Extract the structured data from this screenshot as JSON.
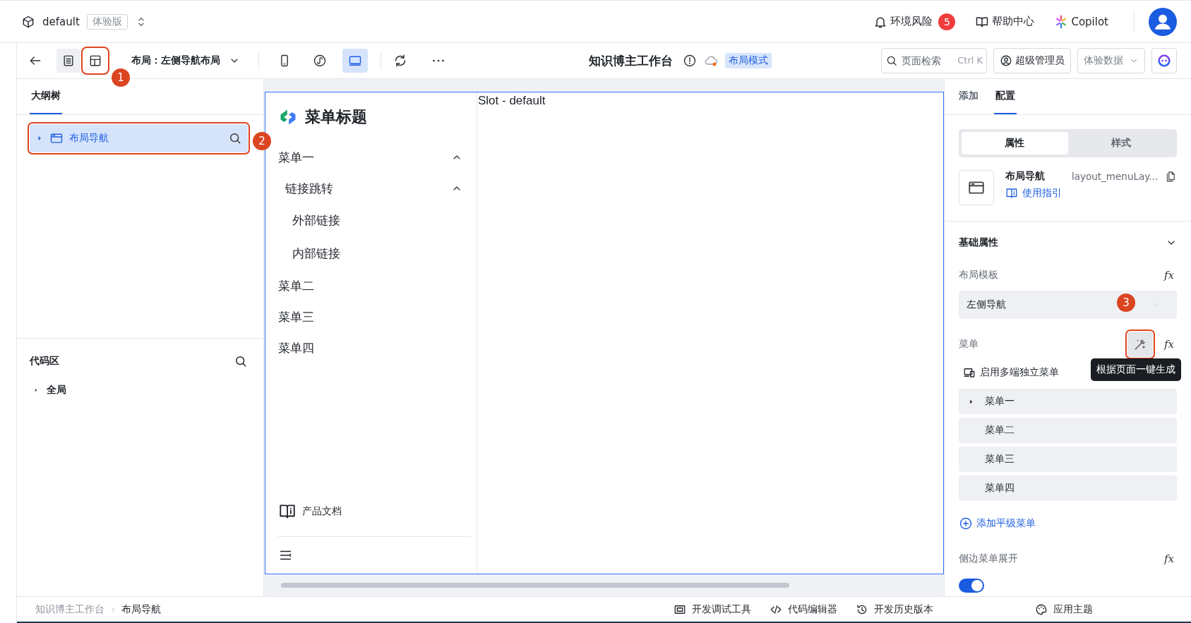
{
  "app_bar": {
    "app_name": "default",
    "edition": "体验版",
    "links": [
      {
        "kind": "bell",
        "label": "环境风险",
        "badge": "5"
      },
      {
        "kind": "book",
        "label": "帮助中心"
      },
      {
        "kind": "copilot",
        "label": "Copilot"
      }
    ]
  },
  "toolbar": {
    "view_toggles": [
      {
        "kind": "outline",
        "selected": true,
        "highlighted": false
      },
      {
        "kind": "layout",
        "selected": false,
        "highlighted": true,
        "callout": "1"
      }
    ],
    "layout_select": "布局：左侧导航布局",
    "devices": [
      {
        "kind": "mobile",
        "selected": false
      },
      {
        "kind": "miniprogram",
        "selected": false
      },
      {
        "kind": "desktop",
        "selected": true
      }
    ],
    "page_title": "知识博主工作台",
    "mode_tag": "布局模式",
    "search": {
      "placeholder": "页面检索",
      "shortcut": "Ctrl K"
    },
    "role": "超级管理员",
    "data_select": "体验数据"
  },
  "left_panel": {
    "tabs": [
      {
        "label": "大纲树",
        "selected": true
      }
    ],
    "tree": [
      {
        "label": "布局导航",
        "selected": true,
        "expanded": false,
        "highlighted": true,
        "callout": "2"
      }
    ],
    "code_section": {
      "title": "代码区",
      "tree": [
        {
          "label": "全局",
          "expanded": false
        }
      ]
    }
  },
  "canvas": {
    "menu_title": "菜单标题",
    "menu": [
      {
        "label": "菜单一",
        "expanded": true,
        "children": [
          {
            "label": "链接跳转",
            "expanded": true,
            "children": [
              {
                "label": "外部链接"
              },
              {
                "label": "内部链接"
              }
            ]
          }
        ]
      },
      {
        "label": "菜单二"
      },
      {
        "label": "菜单三"
      },
      {
        "label": "菜单四"
      }
    ],
    "footer_link": "产品文档",
    "slot": "Slot - default"
  },
  "right_panel": {
    "tabs": [
      {
        "label": "添加",
        "selected": false
      },
      {
        "label": "配置",
        "selected": true
      }
    ],
    "segments": [
      {
        "label": "属性",
        "selected": true
      },
      {
        "label": "样式",
        "selected": false
      }
    ],
    "component": {
      "name": "布局导航",
      "id": "layout_menuLay...",
      "guide_link": "使用指引"
    },
    "section": {
      "title": "基础属性",
      "expanded": true
    },
    "layout_template": {
      "label": "布局模板",
      "formula": "fx",
      "value": "左侧导航"
    },
    "menu_field": {
      "label": "菜单",
      "formula": "fx",
      "generate_button": {
        "highlighted": true,
        "callout": "3",
        "tooltip": "根据页面一键生成"
      },
      "multi_device_option": "启用多端独立菜单",
      "items": [
        {
          "label": "菜单一",
          "expandable": true
        },
        {
          "label": "菜单二",
          "expandable": false
        },
        {
          "label": "菜单三",
          "expandable": false
        },
        {
          "label": "菜单四",
          "expandable": false
        }
      ],
      "add_link": "添加平级菜单"
    },
    "sidebar_expand": {
      "label": "侧边菜单展开",
      "formula": "fx",
      "on": true
    }
  },
  "status_bar": {
    "breadcrumb": [
      "知识博主工作台",
      "布局导航"
    ],
    "tools": [
      {
        "kind": "debug",
        "label": "开发调试工具"
      },
      {
        "kind": "code",
        "label": "代码编辑器"
      },
      {
        "kind": "history",
        "label": "开发历史版本"
      }
    ],
    "theme_button": "应用主题"
  }
}
